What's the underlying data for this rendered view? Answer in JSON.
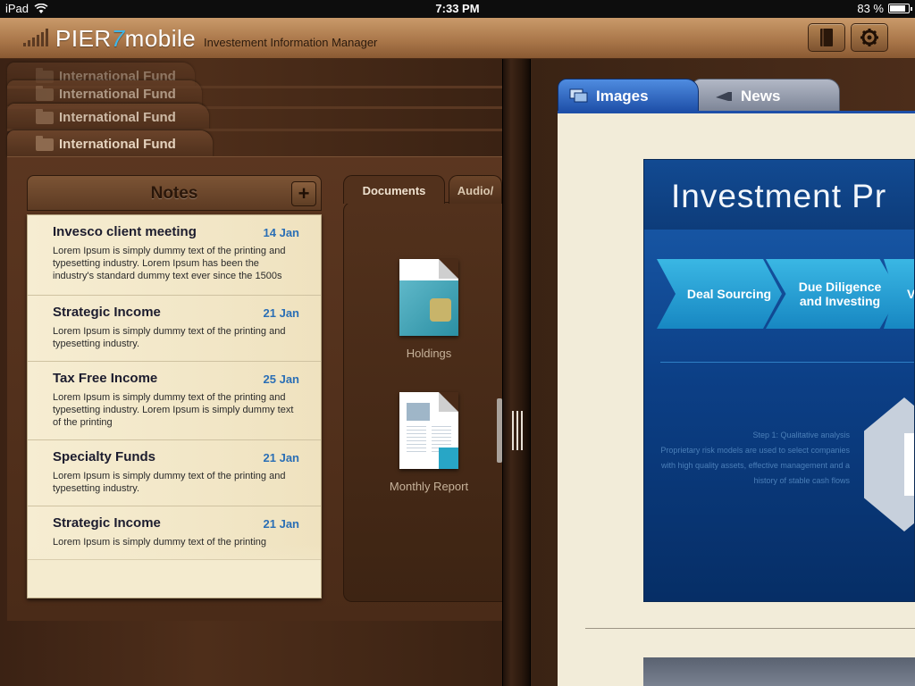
{
  "status_bar": {
    "device": "iPad",
    "time": "7:33 PM",
    "battery_text": "83 %",
    "battery_level": 0.83
  },
  "header": {
    "brand_pier": "PIER",
    "brand_seven": "7",
    "brand_mobile": "mobile",
    "subtitle": "Investement Information Manager",
    "accent_color": "#3fb6e8"
  },
  "folders": [
    {
      "label": "International Fund"
    },
    {
      "label": "International Fund"
    },
    {
      "label": "International Fund"
    },
    {
      "label": "International Fund"
    }
  ],
  "notes": {
    "title": "Notes",
    "add_label": "+",
    "items": [
      {
        "title": "Invesco client meeting",
        "date": "14 Jan",
        "text": "Lorem Ipsum is simply dummy text of the printing and typesetting industry. Lorem Ipsum has been the industry's standard dummy text ever since the 1500s"
      },
      {
        "title": "Strategic Income",
        "date": "21 Jan",
        "text": "Lorem Ipsum is simply dummy text of the printing and typesetting industry."
      },
      {
        "title": "Tax Free Income",
        "date": "25 Jan",
        "text": "Lorem Ipsum is simply dummy text of the printing and typesetting industry. Lorem Ipsum is simply dummy text of the printing"
      },
      {
        "title": "Specialty Funds",
        "date": "21 Jan",
        "text": "Lorem Ipsum is simply dummy text of the printing and typesetting industry."
      },
      {
        "title": "Strategic Income",
        "date": "21 Jan",
        "text": "Lorem Ipsum is simply dummy text of the printing"
      }
    ]
  },
  "documents": {
    "tabs": [
      {
        "label": "Documents"
      },
      {
        "label": "Audio/"
      }
    ],
    "items": [
      {
        "label": "Holdings",
        "icon": "document-thumbnail"
      },
      {
        "label": "Monthly Report",
        "icon": "document-thumbnail"
      }
    ]
  },
  "viewer": {
    "tabs": [
      {
        "label": "Images",
        "icon": "images-icon"
      },
      {
        "label": "News",
        "icon": "news-icon"
      }
    ],
    "slide": {
      "title": "Investment Pr",
      "steps": [
        {
          "label": "Deal Sourcing"
        },
        {
          "label": "Due Diligence and Investing"
        },
        {
          "label": "V"
        }
      ],
      "step_heading": "Step 1: Qualitative analysis",
      "step_body": "Proprietary risk models are used to select companies with high quality assets, effective management and a history of stable cash flows"
    }
  }
}
